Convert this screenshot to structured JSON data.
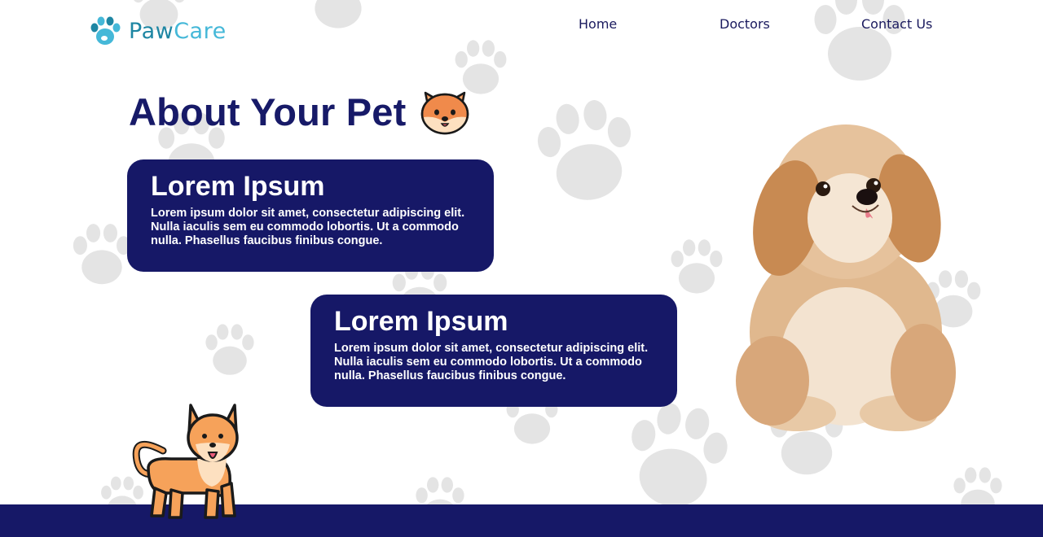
{
  "brand": {
    "word1": "Paw",
    "word2": "Care"
  },
  "nav": {
    "home": "Home",
    "doctors": "Doctors",
    "contact": "Contact Us"
  },
  "page": {
    "title": "About Your Pet"
  },
  "cards": [
    {
      "title": "Lorem Ipsum",
      "body": "Lorem ipsum dolor sit amet, consectetur adipiscing elit. Nulla iaculis sem eu commodo lobortis. Ut a commodo nulla. Phasellus faucibus finibus congue."
    },
    {
      "title": "Lorem Ipsum",
      "body": "Lorem ipsum dolor sit amet, consectetur adipiscing elit. Nulla iaculis sem eu commodo lobortis. Ut a commodo nulla. Phasellus faucibus finibus congue."
    }
  ],
  "colors": {
    "primary": "#161867",
    "logo_dark": "#1e86a3",
    "logo_light": "#45b8d8",
    "paw_bg": "#e4e4e4"
  },
  "icons": [
    "paw-logo-icon",
    "shiba-face-icon",
    "puppy-photo",
    "shiba-dog-illustration",
    "paw-print-background"
  ]
}
